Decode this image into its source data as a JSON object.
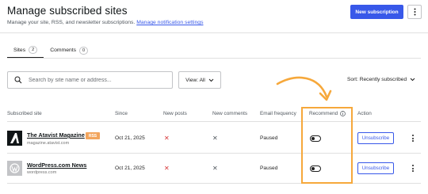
{
  "header": {
    "title": "Manage subscribed sites",
    "subtitle": "Manage your site, RSS, and newsletter subscriptions.",
    "settings_link": "Manage notification settings",
    "new_button": "New subscription"
  },
  "tabs": [
    {
      "label": "Sites",
      "count": "2"
    },
    {
      "label": "Comments",
      "count": "0"
    }
  ],
  "search": {
    "placeholder": "Search by site name or address..."
  },
  "view": {
    "label": "View: All"
  },
  "sort": {
    "label": "Sort: Recently subscribed"
  },
  "table": {
    "headers": [
      "Subscribed site",
      "Since",
      "New posts",
      "New comments",
      "Email frequency",
      "Recommend",
      "Action"
    ],
    "rows": [
      {
        "name": "The Atavist Magazine",
        "url": "magazine.atavist.com",
        "tag": "RSS",
        "since": "Oct 21, 2025",
        "email_frequency": "Paused",
        "action": "Unsubscribe",
        "new_posts": false,
        "new_comments": false,
        "recommend": false
      },
      {
        "name": "WordPress.com News",
        "url": "wordpress.com",
        "since": "Oct 21, 2025",
        "email_frequency": "Paused",
        "action": "Unsubscribe",
        "new_posts": false,
        "new_comments": false,
        "recommend": false
      }
    ]
  },
  "colors": {
    "accent": "#3858e9",
    "highlight": "#f6a83b",
    "rss": "#f2a55d",
    "error": "#d63638"
  }
}
